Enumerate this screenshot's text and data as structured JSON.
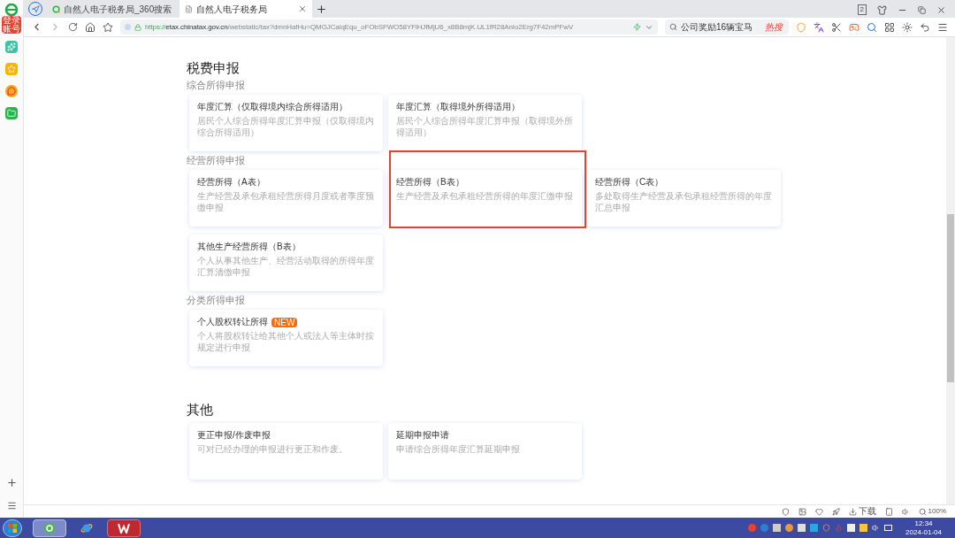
{
  "browser": {
    "tabs": [
      {
        "title": "自然人电子税务局_360搜索",
        "selected": false
      },
      {
        "title": "自然人电子税务局",
        "selected": true
      }
    ],
    "tab_count": "2",
    "address": {
      "scheme": "https://",
      "host": "etax.chinatax.gov.cn",
      "path": "/webstatic/tax?dmnHafHu=QMGJCalqEqu_oFObSFWO58YFlHJfMjU6_x8B8mjK.UL1fR28AnIo2Erg7F42mPFwV"
    },
    "search": {
      "value": "公司奖励16辆宝马",
      "badge": "热搜"
    },
    "sidebar_badge": "登录账号"
  },
  "sections": [
    {
      "title": "税费申报",
      "groups": [
        {
          "title": "综合所得申报",
          "cards": [
            {
              "title": "年度汇算（仅取得境内综合所得适用）",
              "description": "居民个人综合所得年度汇算申报（仅取得境内综合所得适用）",
              "highlighted": false
            },
            {
              "title": "年度汇算（取得境外所得适用）",
              "description": "居民个人综合所得年度汇算申报（取得境外所得适用）",
              "highlighted": false
            }
          ]
        },
        {
          "title": "经营所得申报",
          "cards": [
            {
              "title": "经营所得（A表）",
              "description": "生产经营及承包承租经营所得月度或者季度预缴申报",
              "highlighted": false
            },
            {
              "title": "经营所得（B表）",
              "description": "生产经营及承包承租经营所得的年度汇缴申报",
              "highlighted": true
            },
            {
              "title": "经营所得（C表）",
              "description": "多处取得生产经营及承包承租经营所得的年度汇总申报",
              "highlighted": false
            },
            {
              "title": "其他生产经营所得（B表）",
              "description": "个人从事其他生产、经营活动取得的所得年度汇算清缴申报",
              "highlighted": false
            }
          ]
        },
        {
          "title": "分类所得申报",
          "cards": [
            {
              "title": "个人股权转让所得",
              "badge": "NEW",
              "description": "个人将股权转让给其他个人或法人等主体时按规定进行申报",
              "highlighted": false
            }
          ]
        }
      ]
    },
    {
      "title": "其他",
      "groups": [
        {
          "cards": [
            {
              "title": "更正申报/作废申报",
              "description": "可对已经办理的申报进行更正和作废。",
              "highlighted": false
            },
            {
              "title": "延期申报申请",
              "description": "申请综合所得年度汇算延期申报",
              "highlighted": false
            }
          ]
        }
      ]
    }
  ],
  "status_bar": {
    "download": "下载",
    "zoom": "100%"
  },
  "taskbar": {
    "time": "12:34",
    "date": "2024-01-04"
  }
}
